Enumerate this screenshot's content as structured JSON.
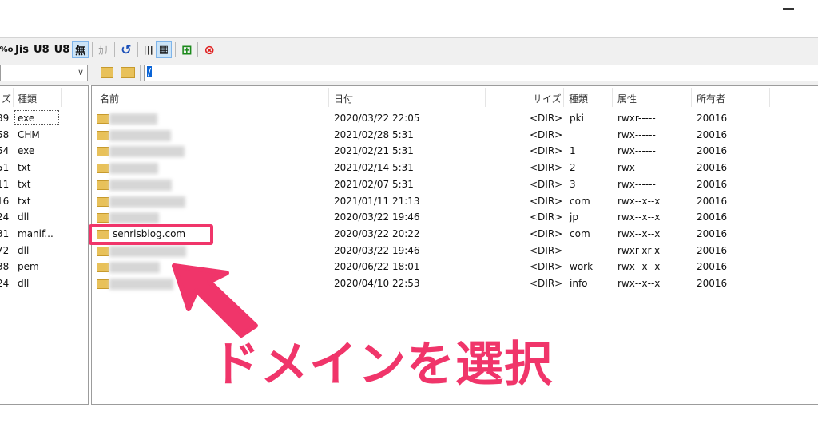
{
  "toolbar": {
    "buttons": [
      {
        "name": "charset-cut-button",
        "label": "%o",
        "selected": false,
        "dim": false
      },
      {
        "name": "charset-jis-button",
        "label": "Jis",
        "selected": false,
        "dim": false
      },
      {
        "name": "charset-utf8-button",
        "label": "U8",
        "selected": false,
        "dim": false
      },
      {
        "name": "charset-utf8n-button",
        "label": "U8",
        "selected": false,
        "dim": false
      },
      {
        "name": "charset-none-button",
        "label": "無",
        "selected": true,
        "dim": false
      }
    ],
    "kana_label": "ｶﾅ",
    "refresh_icon": "↺",
    "list_icon": "|||",
    "detail_icon": "▦",
    "tree_icon": "⊞",
    "stop_icon": "⊗"
  },
  "addressbar": {
    "left_combo_arrow": "∨",
    "path": "/"
  },
  "left_pane": {
    "headers": [
      "ズ",
      "種類"
    ],
    "rows": [
      [
        "39",
        "exe"
      ],
      [
        "58",
        "CHM"
      ],
      [
        "54",
        "exe"
      ],
      [
        "51",
        "txt"
      ],
      [
        "11",
        "txt"
      ],
      [
        "16",
        "txt"
      ],
      [
        "24",
        "dll"
      ],
      [
        "31",
        "manif..."
      ],
      [
        "72",
        "dll"
      ],
      [
        "38",
        "pem"
      ],
      [
        "24",
        "dll"
      ]
    ]
  },
  "right_pane": {
    "headers": [
      "名前",
      "日付",
      "サイズ",
      "種類",
      "属性",
      "所有者"
    ],
    "rows": [
      {
        "name": "",
        "date": "2020/03/22 22:05",
        "size": "<DIR>",
        "type": "pki",
        "attr": "rwxr-----",
        "owner": "20016"
      },
      {
        "name": "",
        "date": "2021/02/28  5:31",
        "size": "<DIR>",
        "type": "",
        "attr": "rwx------",
        "owner": "20016"
      },
      {
        "name": "",
        "date": "2021/02/21  5:31",
        "size": "<DIR>",
        "type": "1",
        "attr": "rwx------",
        "owner": "20016"
      },
      {
        "name": "",
        "date": "2021/02/14  5:31",
        "size": "<DIR>",
        "type": "2",
        "attr": "rwx------",
        "owner": "20016"
      },
      {
        "name": "",
        "date": "2021/02/07  5:31",
        "size": "<DIR>",
        "type": "3",
        "attr": "rwx------",
        "owner": "20016"
      },
      {
        "name": "",
        "date": "2021/01/11 21:13",
        "size": "<DIR>",
        "type": "com",
        "attr": "rwx--x--x",
        "owner": "20016"
      },
      {
        "name": "",
        "date": "2020/03/22 19:46",
        "size": "<DIR>",
        "type": "jp",
        "attr": "rwx--x--x",
        "owner": "20016"
      },
      {
        "name": "senrisblog.com",
        "date": "2020/03/22 20:22",
        "size": "<DIR>",
        "type": "com",
        "attr": "rwx--x--x",
        "owner": "20016"
      },
      {
        "name": "",
        "date": "2020/03/22 19:46",
        "size": "<DIR>",
        "type": "",
        "attr": "rwxr-xr-x",
        "owner": "20016"
      },
      {
        "name": "",
        "date": "2020/06/22 18:01",
        "size": "<DIR>",
        "type": "work",
        "attr": "rwx--x--x",
        "owner": "20016"
      },
      {
        "name": "",
        "date": "2020/04/10 22:53",
        "size": "<DIR>",
        "type": "info",
        "attr": "rwx--x--x",
        "owner": "20016"
      }
    ]
  },
  "annotation": {
    "callout": "ドメインを選択",
    "color": "#f0356a"
  }
}
